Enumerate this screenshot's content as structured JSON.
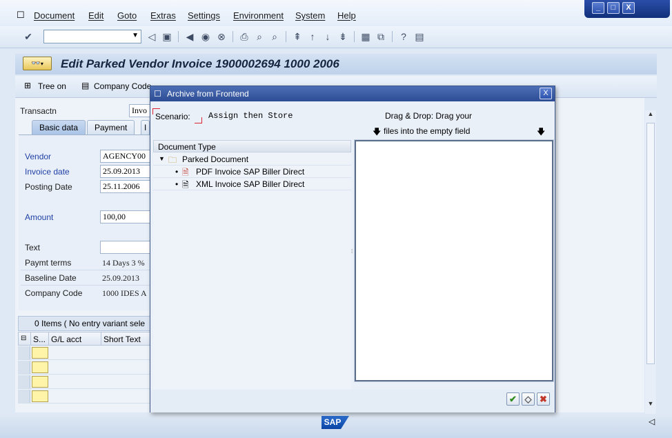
{
  "menu": {
    "items": [
      "Document",
      "Edit",
      "Goto",
      "Extras",
      "Settings",
      "Environment",
      "System",
      "Help"
    ]
  },
  "window_controls": {
    "minimize": "_",
    "maximize": "□",
    "close": "X"
  },
  "toolbar": {
    "command_field_value": ""
  },
  "screen": {
    "title": "Edit Parked Vendor Invoice 1900002694 1000 2006",
    "app_toolbar": {
      "tree_on": "Tree on",
      "company_code": "Company Code"
    },
    "transaction_label": "Transactn",
    "transaction_value": "Invo",
    "tabs": [
      "Basic data",
      "Payment",
      "I"
    ],
    "fields": {
      "vendor_label": "Vendor",
      "vendor_value": "AGENCY00",
      "invoice_date_label": "Invoice date",
      "invoice_date_value": "25.09.2013",
      "posting_date_label": "Posting Date",
      "posting_date_value": "25.11.2006",
      "amount_label": "Amount",
      "amount_value": "100,00",
      "text_label": "Text",
      "text_value": "",
      "payment_terms_label": "Paymt terms",
      "payment_terms_value": "14 Days 3 %",
      "baseline_date_label": "Baseline Date",
      "baseline_date_value": "25.09.2013",
      "company_code_label": "Company Code",
      "company_code_value": "1000 IDES A"
    },
    "items_header": "0 Items ( No entry variant sele",
    "grid_columns": [
      "S...",
      "G/L acct",
      "Short Text"
    ]
  },
  "dialog": {
    "title": "Archive from Frontend",
    "close": "X",
    "scenario_label": "Scenario:",
    "scenario_value": "Assign then Store",
    "drag_drop_line1": "Drag & Drop: Drag your",
    "drag_drop_line2": "files into the empty field",
    "document_type_header": "Document Type",
    "tree": {
      "folder": "Parked Document",
      "items": [
        "PDF Invoice SAP Biller Direct",
        "XML Invoice SAP Biller Direct"
      ]
    },
    "buttons": {
      "ok": "✔",
      "clear": "◇",
      "cancel": "✖"
    }
  },
  "status": {
    "logo": "SAP"
  },
  "colors": {
    "accent": "#2c4c93",
    "background": "#dfe9f5",
    "required_field": "#fff4a8"
  }
}
